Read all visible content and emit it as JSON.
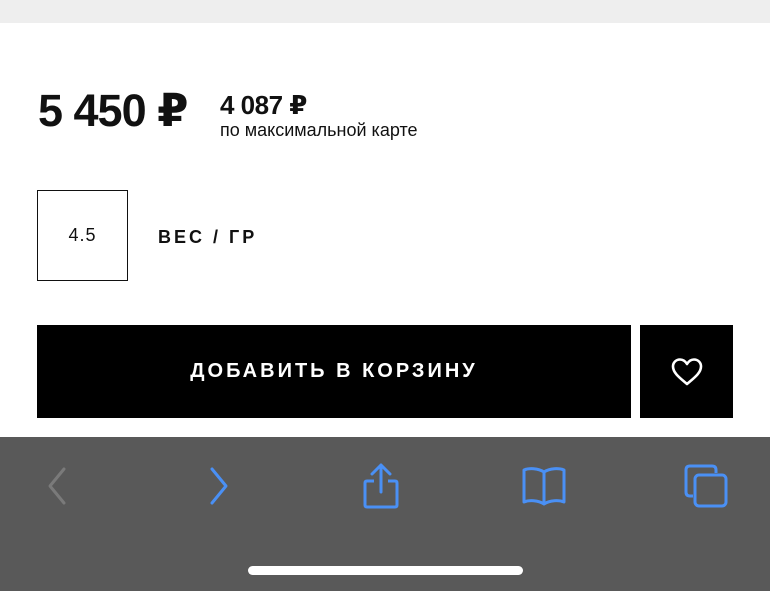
{
  "product": {
    "price": "5 450 ₽",
    "card_price": "4 087 ₽",
    "card_price_note": "по максимальной карте",
    "weight_value": "4.5",
    "weight_label": "ВЕС / ГР"
  },
  "actions": {
    "add_to_cart_label": "ДОБАВИТЬ В КОРЗИНУ",
    "favorite_icon": "heart-icon"
  },
  "browser_toolbar": {
    "icons": [
      "chevron-left-icon",
      "chevron-right-icon",
      "share-icon",
      "book-icon",
      "tabs-icon"
    ],
    "back_enabled": false,
    "accent_color": "#4a90f5",
    "disabled_color": "#7a7a7a"
  }
}
